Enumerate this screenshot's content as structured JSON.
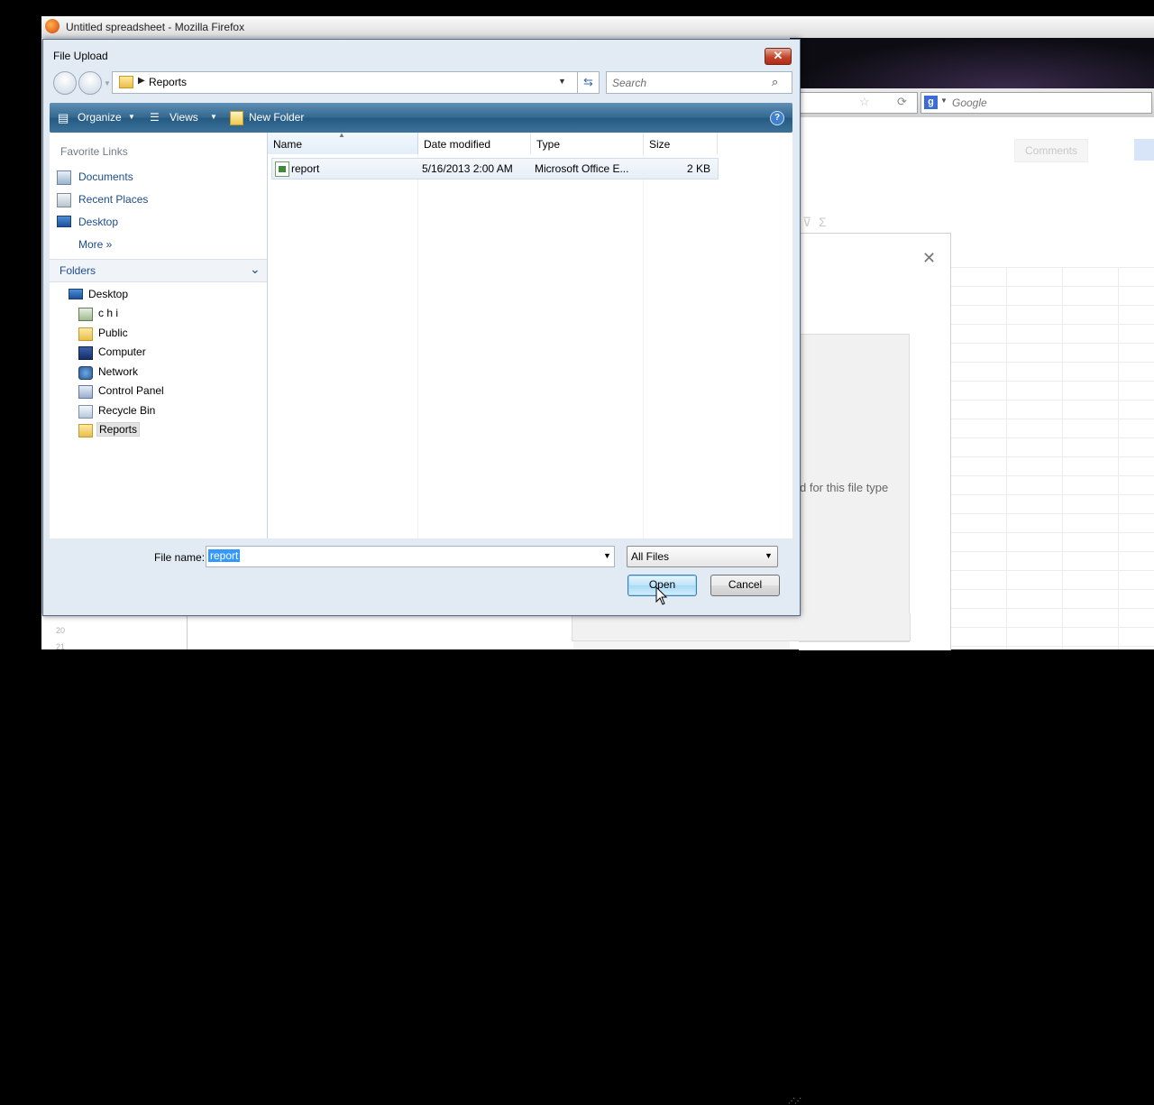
{
  "browser": {
    "title": "Untitled spreadsheet - Mozilla Firefox",
    "search_placeholder": "Google",
    "comments_button": "Comments"
  },
  "background_dialog": {
    "partial_text": "d for this file type",
    "row_numbers": [
      "20",
      "21"
    ]
  },
  "dialog": {
    "title": "File Upload",
    "close_label": "✕",
    "address": {
      "current_folder": "Reports"
    },
    "search_placeholder": "Search",
    "command_bar": {
      "organize": "Organize",
      "views": "Views",
      "new_folder": "New Folder",
      "help": "?"
    },
    "favorite_links": {
      "heading": "Favorite Links",
      "items": [
        {
          "label": "Documents",
          "icon": "documents-icon"
        },
        {
          "label": "Recent Places",
          "icon": "recent-places-icon"
        },
        {
          "label": "Desktop",
          "icon": "desktop-icon"
        },
        {
          "label": "More  »",
          "icon": "none"
        }
      ]
    },
    "folders": {
      "heading": "Folders",
      "tree": [
        {
          "label": "Desktop",
          "icon": "desktop-icon",
          "level": 0
        },
        {
          "label": "c h i",
          "icon": "user-folder-icon",
          "level": 1
        },
        {
          "label": "Public",
          "icon": "folder-icon",
          "level": 1
        },
        {
          "label": "Computer",
          "icon": "computer-icon",
          "level": 1
        },
        {
          "label": "Network",
          "icon": "network-icon",
          "level": 1
        },
        {
          "label": "Control Panel",
          "icon": "control-panel-icon",
          "level": 1
        },
        {
          "label": "Recycle Bin",
          "icon": "recycle-bin-icon",
          "level": 1
        },
        {
          "label": "Reports",
          "icon": "folder-icon",
          "level": 1,
          "selected": true
        }
      ]
    },
    "columns": {
      "name": "Name",
      "date_modified": "Date modified",
      "type": "Type",
      "size": "Size"
    },
    "files": [
      {
        "name": "report",
        "date_modified": "5/16/2013 2:00 AM",
        "type": "Microsoft Office E...",
        "size": "2 KB"
      }
    ],
    "file_name_label": "File name:",
    "file_name_value": "report",
    "file_type_value": "All Files",
    "open_button": "Open",
    "cancel_button": "Cancel"
  }
}
